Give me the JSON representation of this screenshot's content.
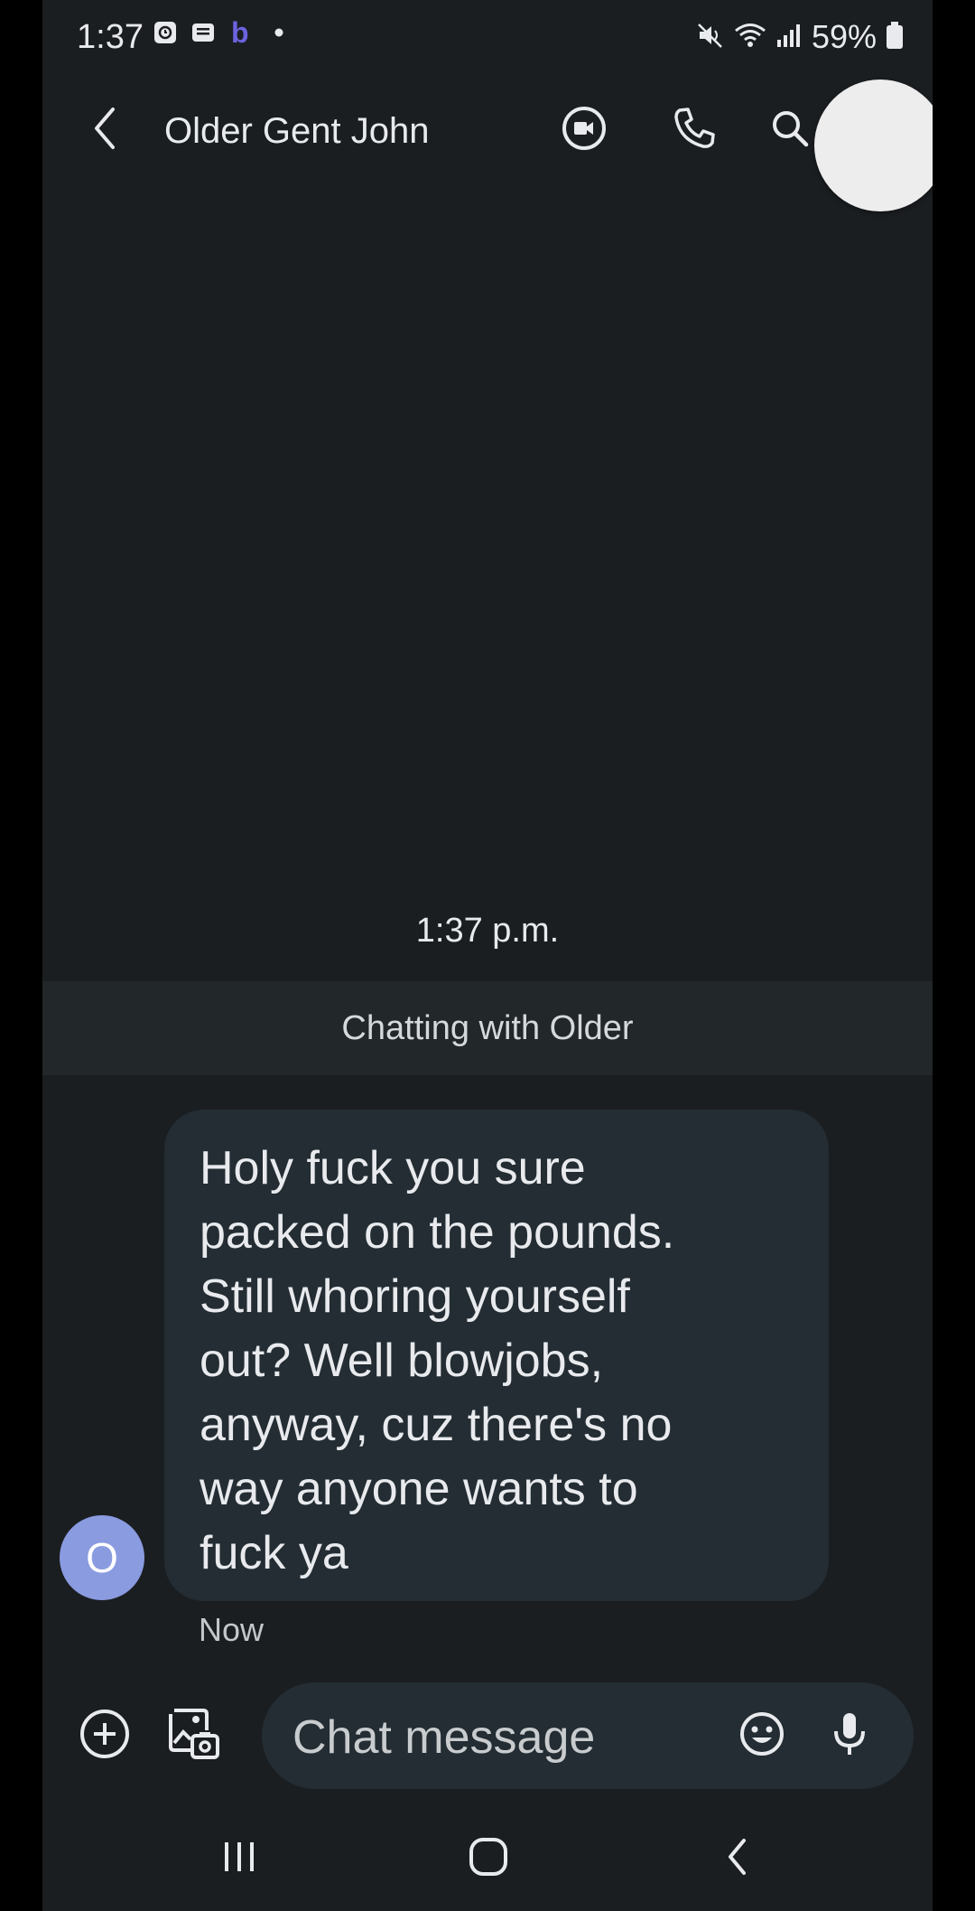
{
  "status_bar": {
    "time": "1:37",
    "battery": "59%",
    "notification_icons": [
      "alarm-icon",
      "message-icon",
      "b-app-icon",
      "dot-icon"
    ],
    "system_icons": [
      "mute-icon",
      "wifi-icon",
      "signal-icon",
      "battery-icon"
    ]
  },
  "header": {
    "contact_name": "Older Gent John",
    "icons": [
      "back-icon",
      "video-call-icon",
      "phone-icon",
      "search-icon"
    ]
  },
  "conversation": {
    "timestamp": "1:37 p.m.",
    "banner": "Chatting with Older",
    "messages": [
      {
        "avatar_letter": "O",
        "text": "Holy fuck you sure\npacked on the pounds.\nStill whoring yourself\nout? Well blowjobs,\nanyway, cuz there's no\nway anyone wants to\nfuck ya",
        "time": "Now"
      }
    ]
  },
  "compose": {
    "placeholder": "Chat message",
    "icons": [
      "add-icon",
      "gallery-icon",
      "emoji-icon",
      "mic-icon"
    ]
  },
  "colors": {
    "background": "#1b1e21",
    "bubble": "#232d33",
    "banner": "#222729",
    "avatar": "#8a9be0",
    "text": "#e8eaed"
  }
}
